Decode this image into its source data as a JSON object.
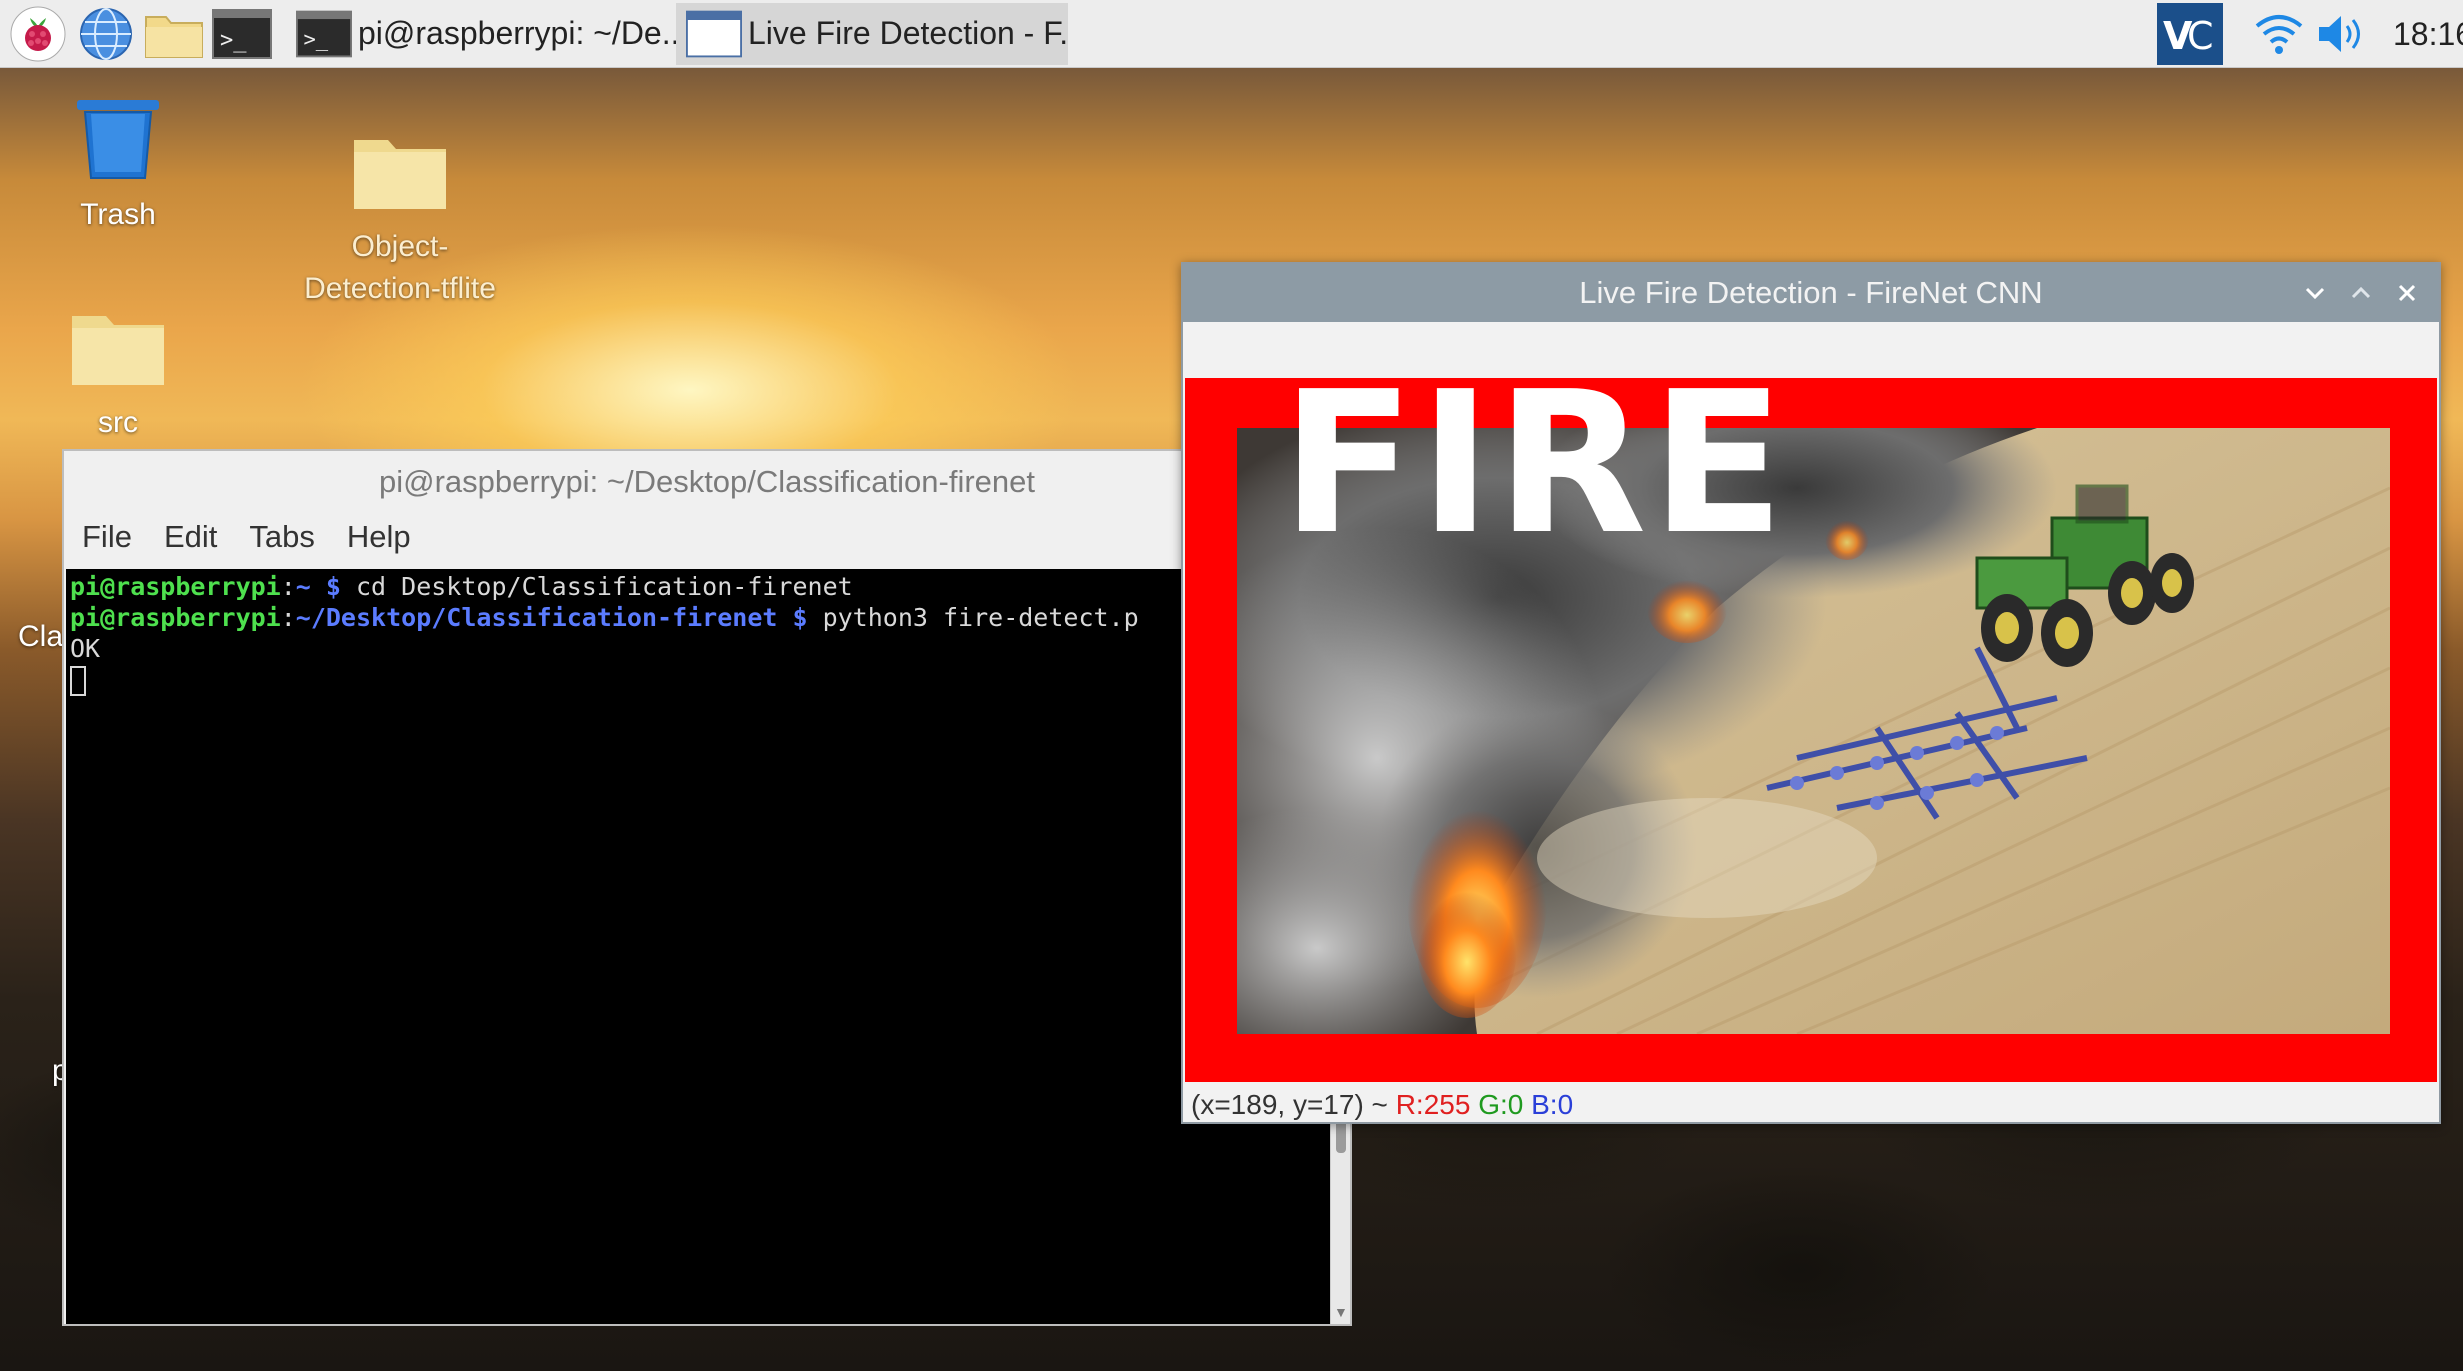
{
  "taskbar": {
    "tasks": [
      {
        "label": "pi@raspberrypi: ~/De..."
      },
      {
        "label": "Live Fire Detection - F..."
      }
    ],
    "clock": "18:16"
  },
  "desktop": {
    "icons": [
      {
        "label": "Trash"
      },
      {
        "label": "Object-\nDetection-tflite"
      },
      {
        "label": "src"
      }
    ],
    "peek_left": "Cla",
    "peek_left2": "p"
  },
  "terminal": {
    "title": "pi@raspberrypi: ~/Desktop/Classification-firenet",
    "menu": [
      "File",
      "Edit",
      "Tabs",
      "Help"
    ],
    "lines": [
      {
        "user": "pi@raspberrypi",
        "path": "~",
        "cmd": "cd Desktop/Classification-firenet"
      },
      {
        "user": "pi@raspberrypi",
        "path": "~/Desktop/Classification-firenet",
        "cmd": "python3 fire-detect.p"
      }
    ],
    "output": "OK"
  },
  "fire_window": {
    "title": "Live Fire Detection - FireNet CNN",
    "overlay_label": "FIRE",
    "status": {
      "coords": "(x=189, y=17) ~",
      "r": "R:255",
      "g": "G:0",
      "b": "B:0"
    }
  },
  "colors": {
    "detection_border": "#ff0000",
    "titlebar": "#8d9ba5",
    "prompt_user": "#4ee04e",
    "prompt_path": "#5b7cff"
  }
}
